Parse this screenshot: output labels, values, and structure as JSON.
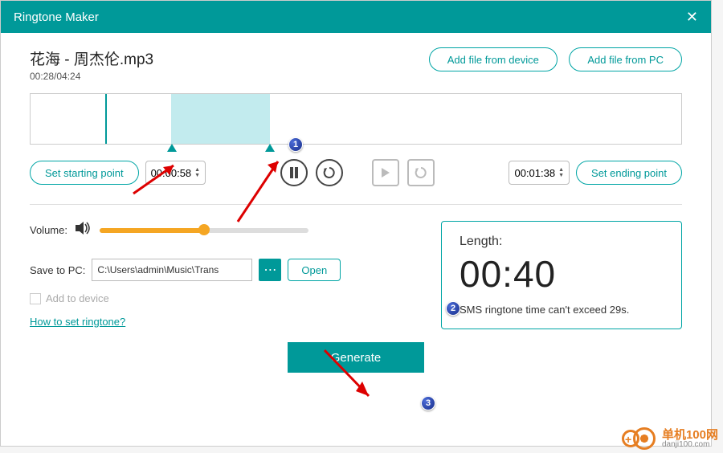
{
  "title": "Ringtone Maker",
  "file": {
    "name": "花海 - 周杰伦.mp3",
    "position": "00:28/04:24"
  },
  "header_buttons": {
    "add_device": "Add file from device",
    "add_pc": "Add file from PC"
  },
  "controls": {
    "set_start": "Set starting point",
    "start_time": "00:00:58",
    "end_time": "00:01:38",
    "set_end": "Set ending point"
  },
  "volume": {
    "label": "Volume:",
    "percent": 50
  },
  "save": {
    "label": "Save to PC:",
    "path": "C:\\Users\\admin\\Music\\Trans",
    "open": "Open",
    "add_device": "Add to device"
  },
  "help_link": "How to set ringtone?",
  "length": {
    "label": "Length:",
    "value": "00:40",
    "hint": "SMS ringtone time can't exceed 29s."
  },
  "generate": "Generate",
  "annotations": {
    "b1": "1",
    "b2": "2",
    "b3": "3"
  },
  "watermark": {
    "cn": "单机100网",
    "en": "danji100.com"
  }
}
